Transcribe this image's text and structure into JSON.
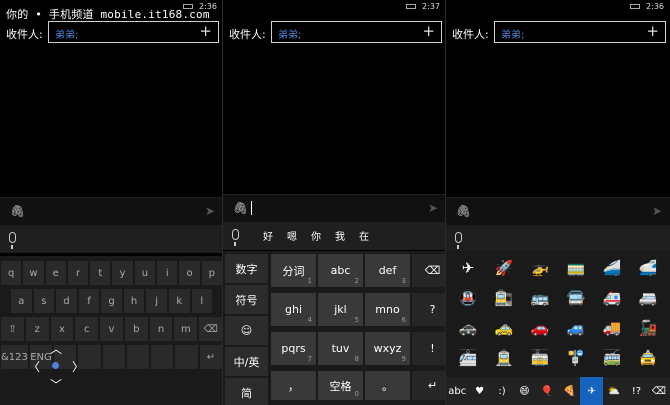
{
  "watermark": "你的 • 手机频道 mobile.it168.com",
  "panels": [
    {
      "time": "2:36"
    },
    {
      "time": "2:37"
    },
    {
      "time": "2:36"
    }
  ],
  "to_label": "收件人:",
  "recipient": "弟弟;",
  "plus": "+",
  "candidates": [
    "好",
    "嗯",
    "你",
    "我",
    "在"
  ],
  "kb1": {
    "row1": [
      "q",
      "w",
      "e",
      "r",
      "t",
      "y",
      "u",
      "i",
      "o",
      "p"
    ],
    "row2": [
      "a",
      "s",
      "d",
      "f",
      "g",
      "h",
      "j",
      "k",
      "l"
    ],
    "row3": [
      "⇧",
      "z",
      "x",
      "c",
      "v",
      "b",
      "n",
      "m",
      "⌫"
    ],
    "row4": [
      "&123",
      "ENG",
      "",
      "",
      "",
      "",
      "",
      "",
      "↵"
    ]
  },
  "kb2": {
    "side": [
      "数字",
      "符号",
      "☺",
      "中/英",
      "简"
    ],
    "grid": [
      {
        "label": "分词",
        "sub": "1"
      },
      {
        "label": "abc",
        "sub": "2"
      },
      {
        "label": "def",
        "sub": "3"
      },
      {
        "label": "ghi",
        "sub": "4"
      },
      {
        "label": "jkl",
        "sub": "5"
      },
      {
        "label": "mno",
        "sub": "6"
      },
      {
        "label": "pqrs",
        "sub": "7"
      },
      {
        "label": "tuv",
        "sub": "8"
      },
      {
        "label": "wxyz",
        "sub": "9"
      }
    ],
    "right": [
      "⌫",
      "?",
      "!"
    ],
    "bottom": [
      {
        "label": "，",
        "sub": ""
      },
      {
        "label": "空格",
        "sub": "0"
      },
      {
        "label": "。",
        "sub": ""
      },
      {
        "label": "↵",
        "sub": ""
      }
    ]
  },
  "emoji": [
    "✈",
    "🚀",
    "🚁",
    "🚃",
    "🚄",
    "🚅",
    "🚇",
    "🚉",
    "🚌",
    "🚍",
    "🚑",
    "🚐",
    "🚓",
    "🚕",
    "🚗",
    "🚙",
    "🚚",
    "🚂",
    "🚈",
    "🚊",
    "🚋",
    "🚏",
    "🚎",
    "🚖"
  ],
  "emoji_bar": [
    "abc",
    "♥",
    ":)",
    "😄",
    "🎈",
    "🍕",
    "✈",
    "⛅",
    "!?",
    "⌫"
  ],
  "emoji_bar_active": 6
}
